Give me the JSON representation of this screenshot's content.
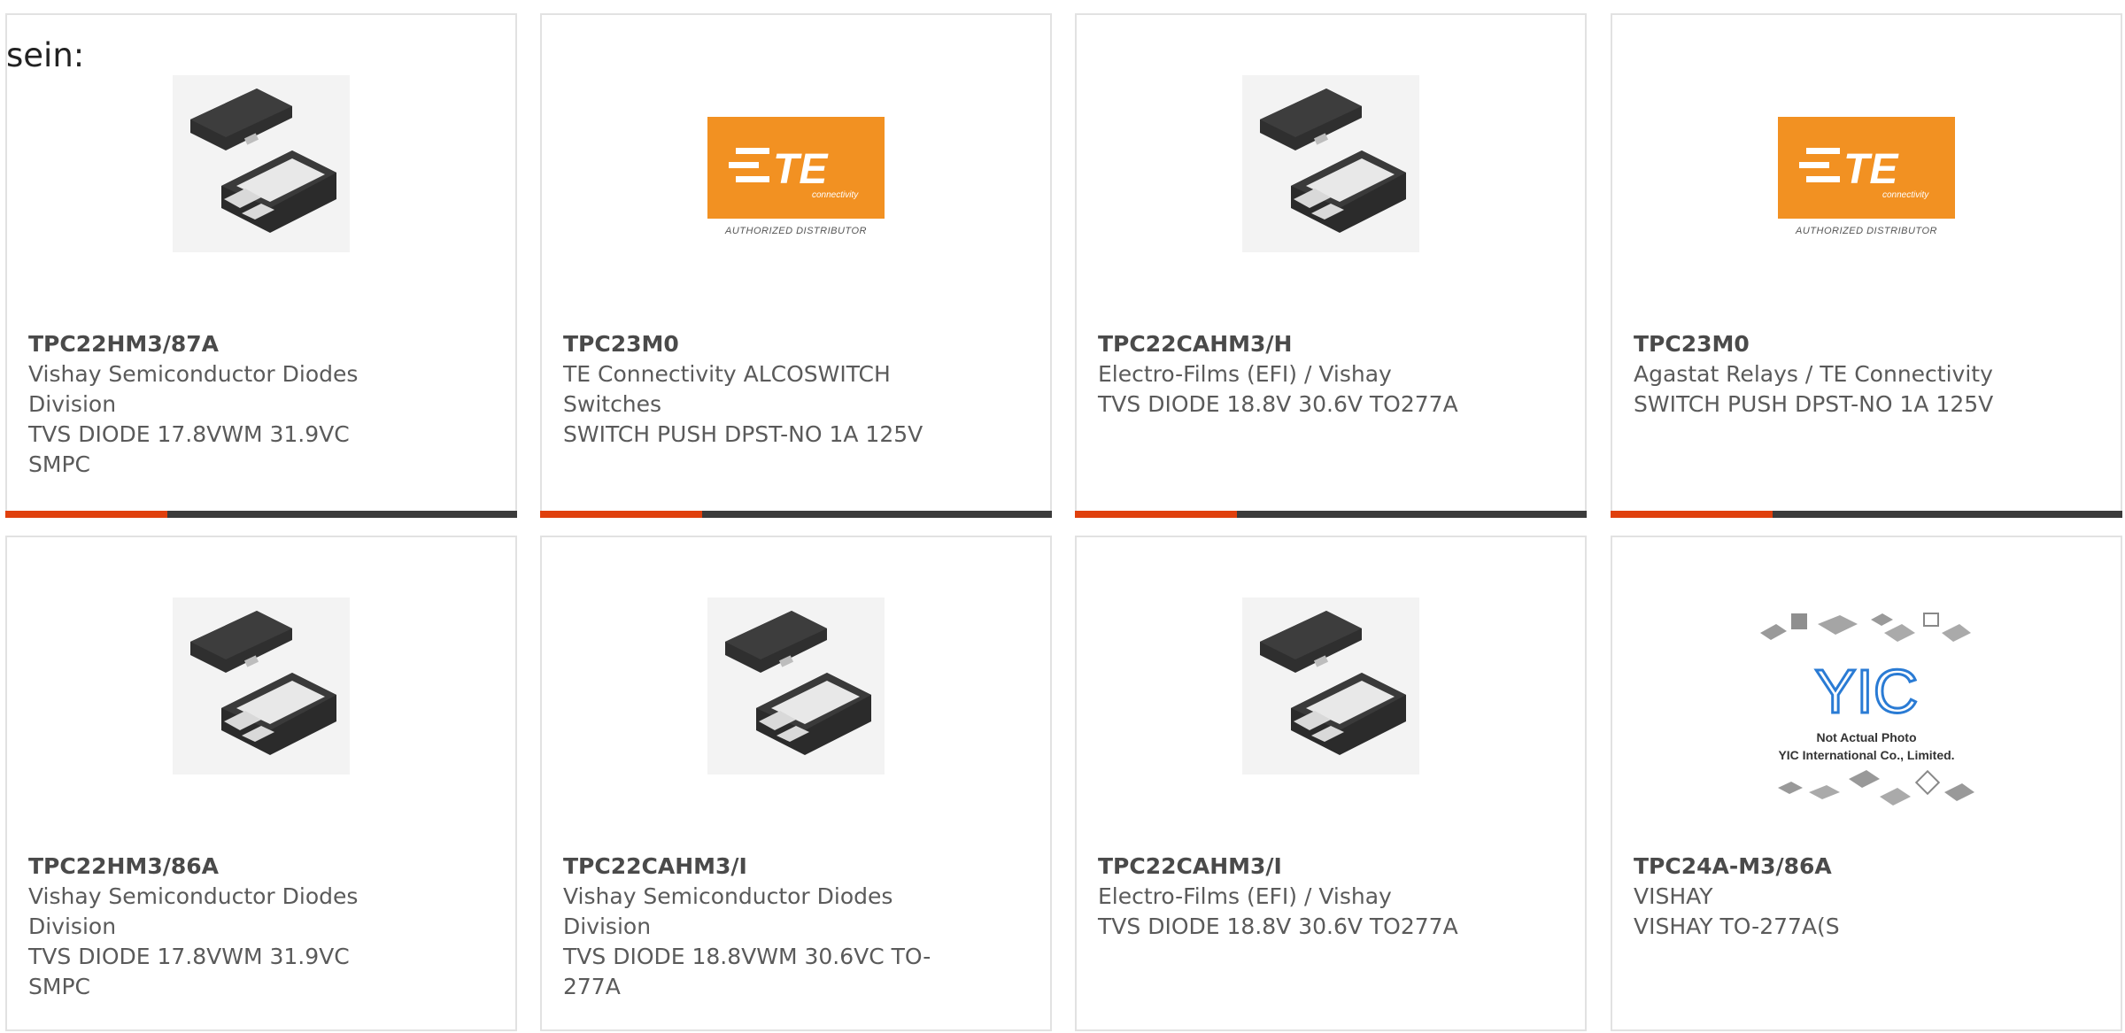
{
  "intro_text": "sein:",
  "colors": {
    "accent": "#e0400d",
    "bar": "#3b3b3b",
    "te_orange": "#f29122",
    "yic_blue": "#2a7bd4"
  },
  "cards": [
    {
      "image": "diode-package",
      "part_number": "TPC22HM3/87A",
      "lines": [
        "Vishay Semiconductor Diodes",
        "Division",
        "TVS DIODE 17.8VWM 31.9VC",
        "SMPC"
      ]
    },
    {
      "image": "te-logo",
      "logo_text": "TE",
      "logo_subtext": "connectivity",
      "logo_caption": "AUTHORIZED DISTRIBUTOR",
      "part_number": "TPC23M0",
      "lines": [
        "TE Connectivity ALCOSWITCH",
        "Switches",
        "SWITCH PUSH DPST-NO 1A 125V"
      ]
    },
    {
      "image": "diode-package",
      "part_number": "TPC22CAHM3/H",
      "lines": [
        "Electro-Films (EFI) / Vishay",
        "TVS DIODE 18.8V 30.6V TO277A"
      ]
    },
    {
      "image": "te-logo",
      "logo_text": "TE",
      "logo_subtext": "connectivity",
      "logo_caption": "AUTHORIZED DISTRIBUTOR",
      "part_number": "TPC23M0",
      "lines": [
        "Agastat Relays / TE Connectivity",
        "SWITCH PUSH DPST-NO 1A 125V"
      ]
    },
    {
      "image": "diode-package",
      "part_number": "TPC22HM3/86A",
      "lines": [
        "Vishay Semiconductor Diodes",
        "Division",
        "TVS DIODE 17.8VWM 31.9VC",
        "SMPC"
      ]
    },
    {
      "image": "diode-package",
      "part_number": "TPC22CAHM3/I",
      "lines": [
        "Vishay Semiconductor Diodes",
        "Division",
        "TVS DIODE 18.8VWM 30.6VC TO-",
        "277A"
      ]
    },
    {
      "image": "diode-package",
      "part_number": "TPC22CAHM3/I",
      "lines": [
        "Electro-Films (EFI) / Vishay",
        "TVS DIODE 18.8V 30.6V TO277A"
      ]
    },
    {
      "image": "yic-placeholder",
      "logo_text": "YIC",
      "logo_caption_1": "Not Actual Photo",
      "logo_caption_2": "YIC International Co., Limited.",
      "part_number": "TPC24A-M3/86A",
      "lines": [
        "VISHAY",
        "VISHAY TO-277A(S"
      ]
    }
  ]
}
